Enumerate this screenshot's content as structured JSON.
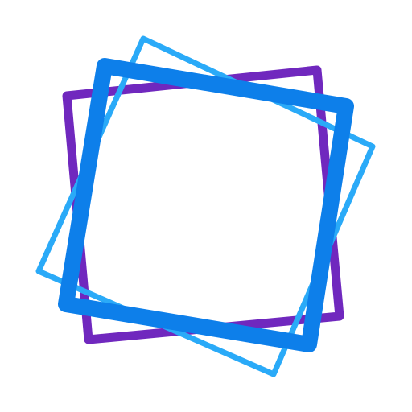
{
  "logo": {
    "icon_name": "rotated-squares-logo-icon",
    "colors": {
      "background": "#ffffff",
      "purple": "#7028BE",
      "blue": "#0D7FEA",
      "light_blue": "#2AAAF8"
    }
  }
}
